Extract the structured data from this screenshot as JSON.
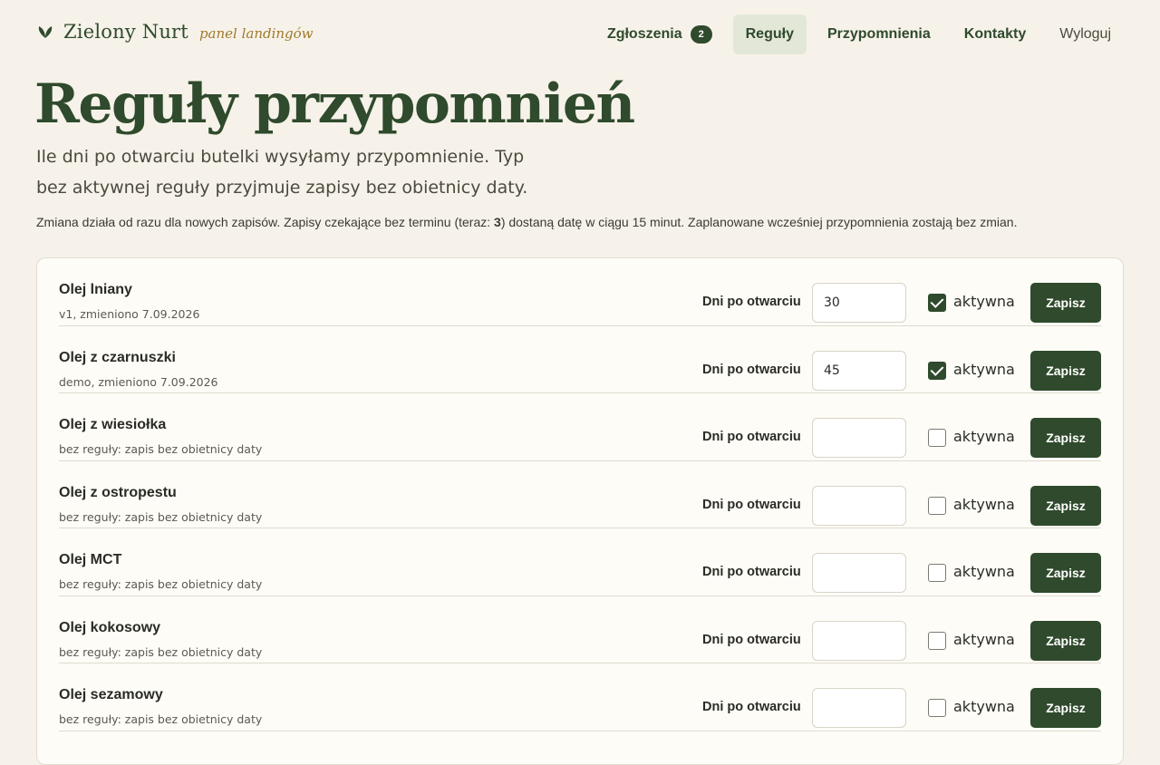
{
  "brand": {
    "name": "Zielony Nurt",
    "subtitle": "panel landingów",
    "logo_icon": "leaf-icon"
  },
  "nav": {
    "zgloszenia": {
      "label": "Zgłoszenia",
      "badge": "2"
    },
    "reguly": {
      "label": "Reguły"
    },
    "przypomnienia": {
      "label": "Przypomnienia"
    },
    "kontakty": {
      "label": "Kontakty"
    },
    "wyloguj": {
      "label": "Wyloguj"
    }
  },
  "page": {
    "title": "Reguły przypomnień",
    "lead": "Ile dni po otwarciu butelki wysyłamy przypomnienie. Typ bez aktywnej reguły przyjmuje zapisy bez obietnicy daty.",
    "note_before": "Zmiana działa od razu dla nowych zapisów. Zapisy czekające bez terminu (teraz: ",
    "note_count": "3",
    "note_after": ") dostaną datę w ciągu 15 minut. Zaplanowane wcześniej przypomnienia zostają bez zmian."
  },
  "labels": {
    "dni": "Dni po otwarciu",
    "aktywna": "aktywna",
    "save": "Zapisz"
  },
  "rows": [
    {
      "name": "Olej lniany",
      "meta": "v1, zmieniono 7.09.2026",
      "days": "30",
      "active": true
    },
    {
      "name": "Olej z czarnuszki",
      "meta": "demo, zmieniono 7.09.2026",
      "days": "45",
      "active": true
    },
    {
      "name": "Olej z wiesiołka",
      "meta": "bez reguły: zapis bez obietnicy daty",
      "days": "",
      "active": false
    },
    {
      "name": "Olej z ostropestu",
      "meta": "bez reguły: zapis bez obietnicy daty",
      "days": "",
      "active": false
    },
    {
      "name": "Olej MCT",
      "meta": "bez reguły: zapis bez obietnicy daty",
      "days": "",
      "active": false
    },
    {
      "name": "Olej kokosowy",
      "meta": "bez reguły: zapis bez obietnicy daty",
      "days": "",
      "active": false
    },
    {
      "name": "Olej sezamowy",
      "meta": "bez reguły: zapis bez obietnicy daty",
      "days": "",
      "active": false
    }
  ],
  "colors": {
    "brand_green": "#2f4a2c",
    "accent_gold": "#a07a2e",
    "page_bg": "#f6f2e9"
  }
}
